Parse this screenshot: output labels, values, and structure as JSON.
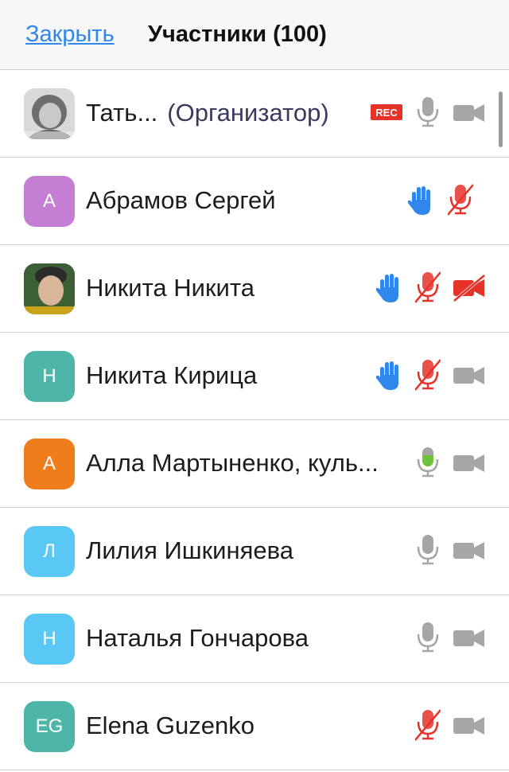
{
  "header": {
    "close_label": "Закрыть",
    "title": "Участники (100)"
  },
  "participants": [
    {
      "name": "Тать...",
      "role": "(Организатор)",
      "avatar": "photo-woman",
      "avatar_color": "#bdbdbd",
      "rec_badge": "REC",
      "hand_raised": false,
      "mic": "on",
      "video": "off"
    },
    {
      "name": "Абрамов Сергей",
      "initials": "А",
      "avatar_color": "#c47fd5",
      "hand_raised": true,
      "mic": "muted",
      "video": "none"
    },
    {
      "name": "Никита Никита",
      "avatar": "photo-boy",
      "avatar_color": "#4f7f4a",
      "hand_raised": true,
      "mic": "muted",
      "video": "muted"
    },
    {
      "name": "Никита Кирица",
      "initials": "Н",
      "avatar_color": "#4db6a9",
      "hand_raised": true,
      "mic": "muted",
      "video": "off"
    },
    {
      "name": "Алла Мартыненко, куль...",
      "initials": "А",
      "avatar_color": "#f07d1c",
      "hand_raised": false,
      "mic": "speaking",
      "video": "off"
    },
    {
      "name": "Лилия Ишкиняева",
      "initials": "Л",
      "avatar_color": "#5ac8f5",
      "hand_raised": false,
      "mic": "on",
      "video": "off"
    },
    {
      "name": "Наталья Гончарова",
      "initials": "Н",
      "avatar_color": "#5ac8f5",
      "hand_raised": false,
      "mic": "on",
      "video": "off"
    },
    {
      "name": "Elena Guzenko",
      "initials": "EG",
      "avatar_color": "#4db6a9",
      "hand_raised": false,
      "mic": "muted",
      "video": "off"
    }
  ],
  "colors": {
    "link": "#2f87ec",
    "muted_red": "#e5332a",
    "hand_blue": "#2f87ec",
    "icon_gray": "#a6a6a6",
    "speaking_green": "#6fc23a"
  },
  "icons": [
    "hand-icon",
    "microphone-icon",
    "microphone-muted-icon",
    "video-camera-icon",
    "video-camera-muted-icon",
    "rec-badge"
  ]
}
